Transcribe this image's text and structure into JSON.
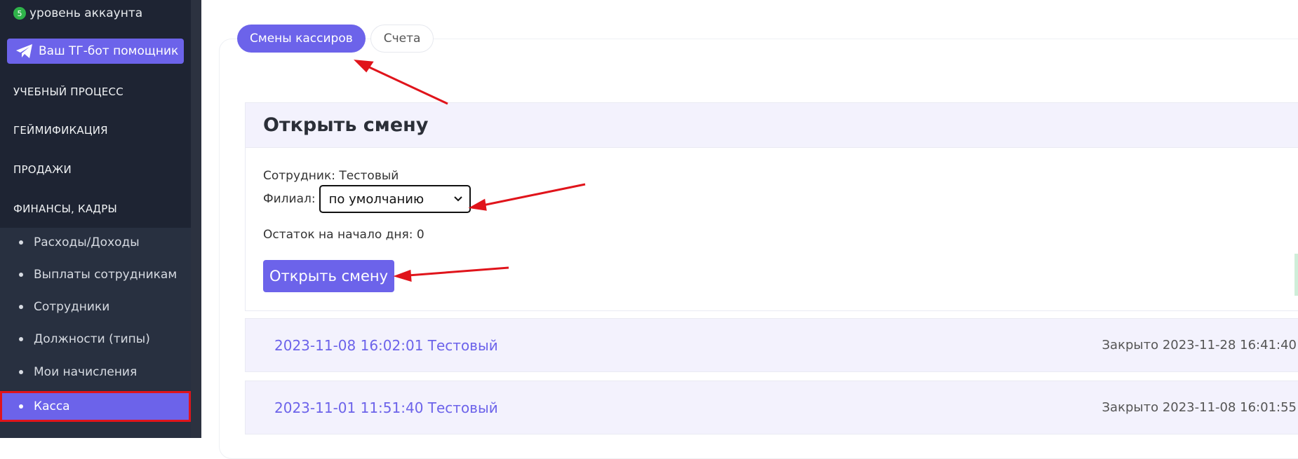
{
  "sidebar": {
    "account": {
      "level": "5",
      "label": "уровень аккаунта"
    },
    "tg_button": {
      "label": "Ваш ТГ-бот помощник"
    },
    "sections": [
      {
        "label": "УЧЕБНЫЙ ПРОЦЕСС"
      },
      {
        "label": "ГЕЙМИФИКАЦИЯ"
      },
      {
        "label": "ПРОДАЖИ"
      },
      {
        "label": "ФИНАНСЫ, КАДРЫ"
      }
    ],
    "finance_items": [
      {
        "label": "Расходы/Доходы"
      },
      {
        "label": "Выплаты сотрудникам"
      },
      {
        "label": "Сотрудники"
      },
      {
        "label": "Должности (типы)"
      },
      {
        "label": "Мои начисления"
      },
      {
        "label": "Касса",
        "active": true
      }
    ]
  },
  "tabs": [
    {
      "label": "Смены кассиров",
      "active": true
    },
    {
      "label": "Счета",
      "active": false
    }
  ],
  "open_shift": {
    "title": "Открыть смену",
    "employee": "Сотрудник: Тестовый",
    "branch_label": "Филиал:",
    "branch_value": "по умолчанию",
    "balance": "Остаток на начало дня: 0",
    "button": "Открыть смену"
  },
  "shifts": [
    {
      "opened": "2023-11-08 16:02:01 Тестовый",
      "closed": "Закрыто 2023-11-28 16:41:40"
    },
    {
      "opened": "2023-11-01 11:51:40 Тестовый",
      "closed": "Закрыто 2023-11-08 16:01:55"
    }
  ],
  "colors": {
    "accent": "#6c63ea",
    "sidebar_bg": "#1e2433",
    "annotation_arrow": "#e0141b"
  }
}
